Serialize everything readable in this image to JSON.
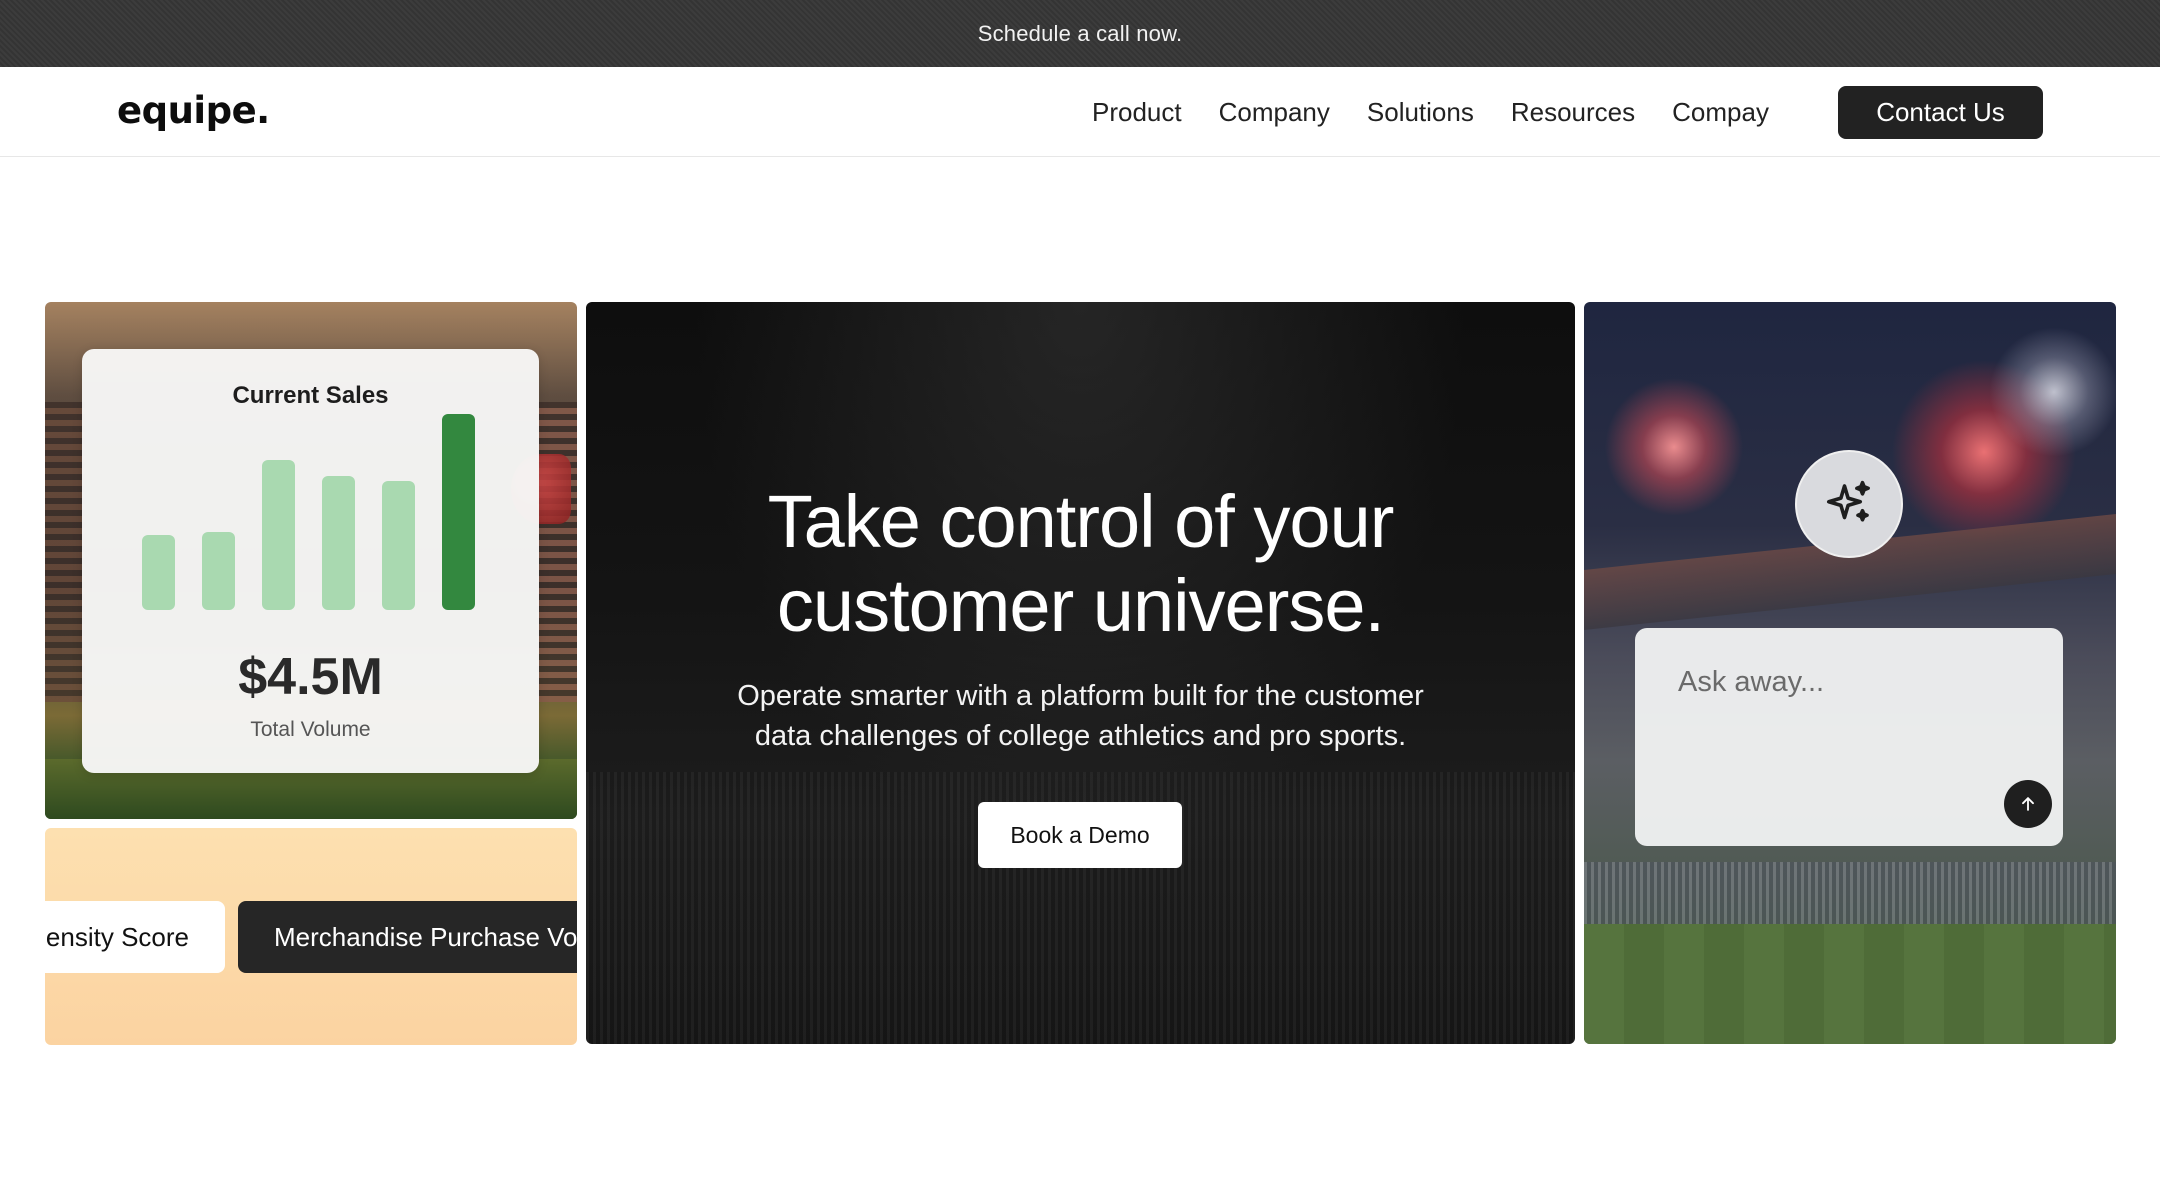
{
  "announcement": {
    "text": "Schedule a call now."
  },
  "nav": {
    "logo": "equipe.",
    "items": [
      {
        "label": "Product"
      },
      {
        "label": "Company"
      },
      {
        "label": "Solutions"
      },
      {
        "label": "Resources"
      },
      {
        "label": "Compay"
      }
    ],
    "cta": "Contact Us"
  },
  "sales_card": {
    "title": "Current Sales",
    "value": "$4.5M",
    "subtitle": "Total Volume",
    "bar_levels": [
      0.28,
      0.29,
      0.56,
      0.5,
      0.48,
      0.73
    ],
    "highlight_index": 5,
    "colors": {
      "bar": "#a9d9b0",
      "bar_highlight": "#33883f"
    }
  },
  "chips": {
    "left": "ensity Score",
    "right": "Merchandise Purchase Vo"
  },
  "hero": {
    "title_line1": "Take control of your",
    "title_line2": "customer universe.",
    "subtitle_line1": "Operate smarter with a platform built for the customer",
    "subtitle_line2": "data challenges of college athletics and pro sports.",
    "cta": "Book a Demo"
  },
  "assistant": {
    "icon": "sparkles-icon",
    "placeholder": "Ask away...",
    "send_icon": "arrow-up-icon"
  }
}
